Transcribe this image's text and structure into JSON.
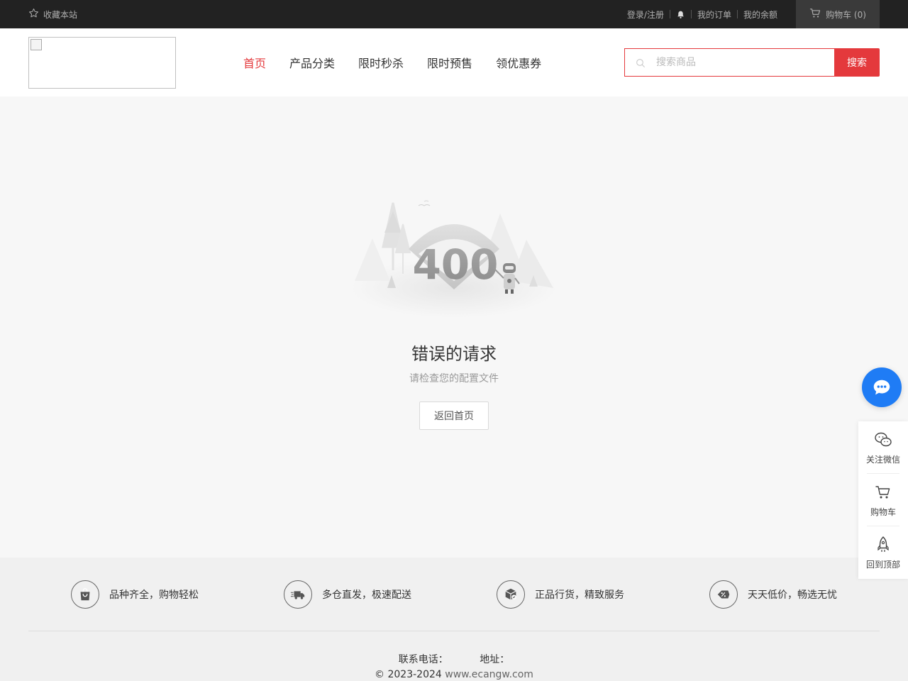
{
  "topbar": {
    "favorite": "收藏本站",
    "login": "登录/注册",
    "orders": "我的订单",
    "balance": "我的余额",
    "cart": "购物车 (0)"
  },
  "nav": {
    "items": [
      "首页",
      "产品分类",
      "限时秒杀",
      "限时预售",
      "领优惠券"
    ],
    "active_index": 0
  },
  "search": {
    "placeholder": "搜索商品",
    "button": "搜索"
  },
  "error": {
    "code": "400",
    "title": "错误的请求",
    "subtitle": "请检查您的配置文件",
    "back_button": "返回首页"
  },
  "features": [
    {
      "icon": "shopping-bag-icon",
      "text": "品种齐全，购物轻松"
    },
    {
      "icon": "delivery-truck-icon",
      "text": "多仓直发，极速配送"
    },
    {
      "icon": "genuine-box-icon",
      "text": "正品行货，精致服务"
    },
    {
      "icon": "discount-tag-icon",
      "text": "天天低价，畅选无忧"
    }
  ],
  "footer": {
    "phone_label": "联系电话：",
    "address_label": "地址：",
    "copyright": "© 2023-2024",
    "domain": "www.ecangw.com"
  },
  "sidepanel": {
    "wechat": "关注微信",
    "cart": "购物车",
    "top": "回到顶部"
  },
  "colors": {
    "accent": "#e4393c",
    "topbar_bg": "#222222",
    "chat_blue": "#1f7cf5"
  }
}
